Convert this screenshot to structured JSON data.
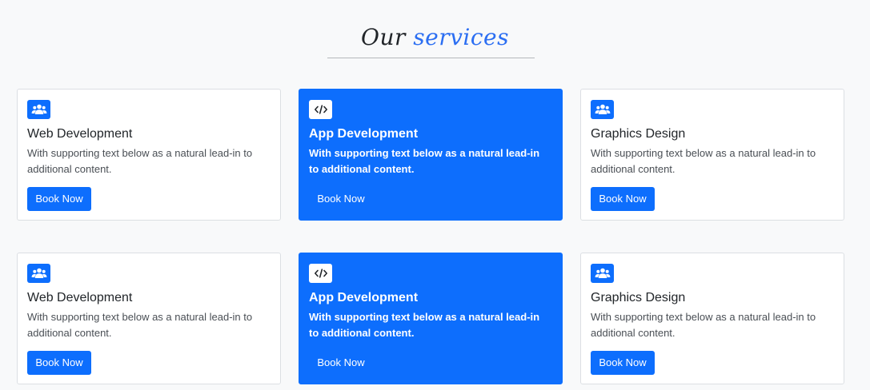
{
  "heading": {
    "lead": "Our",
    "accent": "services"
  },
  "colors": {
    "primary": "#0d6efd",
    "background": "#f8f9fa",
    "card_background": "#ffffff"
  },
  "cards": [
    {
      "icon": "users-icon",
      "title": "Web Development",
      "text": "With supporting text below as a natural lead-in to additional content.",
      "button_label": "Book Now",
      "featured": false
    },
    {
      "icon": "code-icon",
      "title": "App Development",
      "text": "With supporting text below as a natural lead-in to additional content.",
      "button_label": "Book Now",
      "featured": true
    },
    {
      "icon": "users-icon",
      "title": "Graphics Design",
      "text": "With supporting text below as a natural lead-in to additional content.",
      "button_label": "Book Now",
      "featured": false
    },
    {
      "icon": "users-icon",
      "title": "Web Development",
      "text": "With supporting text below as a natural lead-in to additional content.",
      "button_label": "Book Now",
      "featured": false
    },
    {
      "icon": "code-icon",
      "title": "App Development",
      "text": "With supporting text below as a natural lead-in to additional content.",
      "button_label": "Book Now",
      "featured": true
    },
    {
      "icon": "users-icon",
      "title": "Graphics Design",
      "text": "With supporting text below as a natural lead-in to additional content.",
      "button_label": "Book Now",
      "featured": false
    }
  ]
}
